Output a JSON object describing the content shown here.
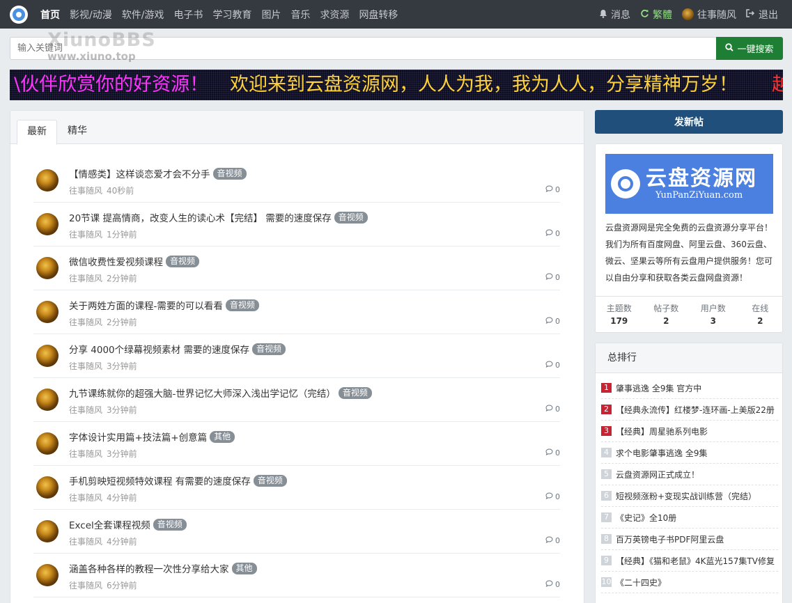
{
  "nav": {
    "items": [
      "首页",
      "影视/动漫",
      "软件/游戏",
      "电子书",
      "学习教育",
      "图片",
      "音乐",
      "求资源",
      "网盘转移"
    ],
    "messages": "消息",
    "traditional": "繁體",
    "user": "往事随风",
    "logout": "退出"
  },
  "search": {
    "placeholder": "输入关键词",
    "button": "一键搜索"
  },
  "watermark": {
    "line1": "XiunoBBS",
    "line2": "www.xiuno.top"
  },
  "banner": {
    "part1": "\\伙伴欣赏你的好资源！",
    "part2": "欢迎来到云盘资源网，人人为我，我为人人，分享精神万岁！",
    "part3": "越"
  },
  "tabs": [
    "最新",
    "精华"
  ],
  "threads": [
    {
      "title": "【情感类】这样谈恋爱才会不分手",
      "tag": "音视频",
      "author": "往事随风",
      "time": "40秒前",
      "replies": "0"
    },
    {
      "title": "20节课 提高情商，改变人生的读心术【完结】 需要的速度保存",
      "tag": "音视频",
      "author": "往事随风",
      "time": "1分钟前",
      "replies": "0"
    },
    {
      "title": "微信收费性爱视频课程",
      "tag": "音视频",
      "author": "往事随风",
      "time": "2分钟前",
      "replies": "0"
    },
    {
      "title": "关于两姓方面的课程-需要的可以看看",
      "tag": "音视频",
      "author": "往事随风",
      "time": "2分钟前",
      "replies": "0"
    },
    {
      "title": "分享 4000个绿幕视频素材 需要的速度保存",
      "tag": "音视频",
      "author": "往事随风",
      "time": "3分钟前",
      "replies": "0"
    },
    {
      "title": "九节课练就你的超强大脑-世界记忆大师深入浅出学记忆（完结）",
      "tag": "音视频",
      "author": "往事随风",
      "time": "3分钟前",
      "replies": "0"
    },
    {
      "title": "字体设计实用篇+技法篇+创意篇",
      "tag": "其他",
      "author": "往事随风",
      "time": "3分钟前",
      "replies": "0"
    },
    {
      "title": "手机剪映短视频特效课程 有需要的速度保存",
      "tag": "音视频",
      "author": "往事随风",
      "time": "4分钟前",
      "replies": "0"
    },
    {
      "title": "Excel全套课程视频",
      "tag": "音视频",
      "author": "往事随风",
      "time": "4分钟前",
      "replies": "0"
    },
    {
      "title": "涵盖各种各样的教程一次性分享给大家",
      "tag": "其他",
      "author": "往事随风",
      "time": "6分钟前",
      "replies": "0"
    }
  ],
  "sidebar": {
    "post_button": "发新帖",
    "logo_cn": "云盘资源网",
    "logo_en": "YunPanZiYuan.com",
    "description": "云盘资源网是完全免费的云盘资源分享平台！我们为所有百度网盘、阿里云盘、360云盘、微云、坚果云等所有云盘用户提供服务！您可以自由分享和获取各类云盘网盘资源！",
    "stats": [
      {
        "label": "主题数",
        "value": "179"
      },
      {
        "label": "帖子数",
        "value": "2"
      },
      {
        "label": "用户数",
        "value": "3"
      },
      {
        "label": "在线",
        "value": "2"
      }
    ],
    "rank_title": "总排行",
    "rank": [
      {
        "n": "1",
        "text": "肇事逃逸 全9集 官方中"
      },
      {
        "n": "2",
        "text": "【经典永流传】红楼梦-连环画-上美版22册"
      },
      {
        "n": "3",
        "text": "【经典】周星驰系列电影"
      },
      {
        "n": "4",
        "text": "求个电影肇事逃逸 全9集"
      },
      {
        "n": "5",
        "text": "云盘资源网正式成立！"
      },
      {
        "n": "6",
        "text": "短视频涨粉+变现实战训练营（完结）"
      },
      {
        "n": "7",
        "text": "《史记》全10册"
      },
      {
        "n": "8",
        "text": "百万英镑电子书PDF阿里云盘"
      },
      {
        "n": "9",
        "text": "【经典】《猫和老鼠》4K蓝光157集TV修复"
      },
      {
        "n": "10",
        "text": "《二十四史》"
      }
    ]
  },
  "colors": {
    "topbar": "#343a40",
    "search_button": "#1e7e34",
    "post_button": "#1f4f7a",
    "rank_top": "#c82333",
    "logo_bg": "#4b7fe0"
  }
}
